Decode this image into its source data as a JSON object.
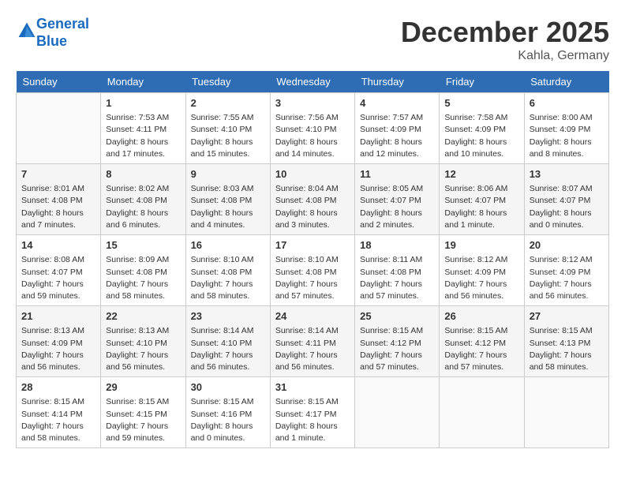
{
  "header": {
    "logo_line1": "General",
    "logo_line2": "Blue",
    "month": "December 2025",
    "location": "Kahla, Germany"
  },
  "weekdays": [
    "Sunday",
    "Monday",
    "Tuesday",
    "Wednesday",
    "Thursday",
    "Friday",
    "Saturday"
  ],
  "weeks": [
    [
      {
        "day": "",
        "empty": true
      },
      {
        "day": "1",
        "sunrise": "Sunrise: 7:53 AM",
        "sunset": "Sunset: 4:11 PM",
        "daylight": "Daylight: 8 hours and 17 minutes."
      },
      {
        "day": "2",
        "sunrise": "Sunrise: 7:55 AM",
        "sunset": "Sunset: 4:10 PM",
        "daylight": "Daylight: 8 hours and 15 minutes."
      },
      {
        "day": "3",
        "sunrise": "Sunrise: 7:56 AM",
        "sunset": "Sunset: 4:10 PM",
        "daylight": "Daylight: 8 hours and 14 minutes."
      },
      {
        "day": "4",
        "sunrise": "Sunrise: 7:57 AM",
        "sunset": "Sunset: 4:09 PM",
        "daylight": "Daylight: 8 hours and 12 minutes."
      },
      {
        "day": "5",
        "sunrise": "Sunrise: 7:58 AM",
        "sunset": "Sunset: 4:09 PM",
        "daylight": "Daylight: 8 hours and 10 minutes."
      },
      {
        "day": "6",
        "sunrise": "Sunrise: 8:00 AM",
        "sunset": "Sunset: 4:09 PM",
        "daylight": "Daylight: 8 hours and 8 minutes."
      }
    ],
    [
      {
        "day": "7",
        "sunrise": "Sunrise: 8:01 AM",
        "sunset": "Sunset: 4:08 PM",
        "daylight": "Daylight: 8 hours and 7 minutes."
      },
      {
        "day": "8",
        "sunrise": "Sunrise: 8:02 AM",
        "sunset": "Sunset: 4:08 PM",
        "daylight": "Daylight: 8 hours and 6 minutes."
      },
      {
        "day": "9",
        "sunrise": "Sunrise: 8:03 AM",
        "sunset": "Sunset: 4:08 PM",
        "daylight": "Daylight: 8 hours and 4 minutes."
      },
      {
        "day": "10",
        "sunrise": "Sunrise: 8:04 AM",
        "sunset": "Sunset: 4:08 PM",
        "daylight": "Daylight: 8 hours and 3 minutes."
      },
      {
        "day": "11",
        "sunrise": "Sunrise: 8:05 AM",
        "sunset": "Sunset: 4:07 PM",
        "daylight": "Daylight: 8 hours and 2 minutes."
      },
      {
        "day": "12",
        "sunrise": "Sunrise: 8:06 AM",
        "sunset": "Sunset: 4:07 PM",
        "daylight": "Daylight: 8 hours and 1 minute."
      },
      {
        "day": "13",
        "sunrise": "Sunrise: 8:07 AM",
        "sunset": "Sunset: 4:07 PM",
        "daylight": "Daylight: 8 hours and 0 minutes."
      }
    ],
    [
      {
        "day": "14",
        "sunrise": "Sunrise: 8:08 AM",
        "sunset": "Sunset: 4:07 PM",
        "daylight": "Daylight: 7 hours and 59 minutes."
      },
      {
        "day": "15",
        "sunrise": "Sunrise: 8:09 AM",
        "sunset": "Sunset: 4:08 PM",
        "daylight": "Daylight: 7 hours and 58 minutes."
      },
      {
        "day": "16",
        "sunrise": "Sunrise: 8:10 AM",
        "sunset": "Sunset: 4:08 PM",
        "daylight": "Daylight: 7 hours and 58 minutes."
      },
      {
        "day": "17",
        "sunrise": "Sunrise: 8:10 AM",
        "sunset": "Sunset: 4:08 PM",
        "daylight": "Daylight: 7 hours and 57 minutes."
      },
      {
        "day": "18",
        "sunrise": "Sunrise: 8:11 AM",
        "sunset": "Sunset: 4:08 PM",
        "daylight": "Daylight: 7 hours and 57 minutes."
      },
      {
        "day": "19",
        "sunrise": "Sunrise: 8:12 AM",
        "sunset": "Sunset: 4:09 PM",
        "daylight": "Daylight: 7 hours and 56 minutes."
      },
      {
        "day": "20",
        "sunrise": "Sunrise: 8:12 AM",
        "sunset": "Sunset: 4:09 PM",
        "daylight": "Daylight: 7 hours and 56 minutes."
      }
    ],
    [
      {
        "day": "21",
        "sunrise": "Sunrise: 8:13 AM",
        "sunset": "Sunset: 4:09 PM",
        "daylight": "Daylight: 7 hours and 56 minutes."
      },
      {
        "day": "22",
        "sunrise": "Sunrise: 8:13 AM",
        "sunset": "Sunset: 4:10 PM",
        "daylight": "Daylight: 7 hours and 56 minutes."
      },
      {
        "day": "23",
        "sunrise": "Sunrise: 8:14 AM",
        "sunset": "Sunset: 4:10 PM",
        "daylight": "Daylight: 7 hours and 56 minutes."
      },
      {
        "day": "24",
        "sunrise": "Sunrise: 8:14 AM",
        "sunset": "Sunset: 4:11 PM",
        "daylight": "Daylight: 7 hours and 56 minutes."
      },
      {
        "day": "25",
        "sunrise": "Sunrise: 8:15 AM",
        "sunset": "Sunset: 4:12 PM",
        "daylight": "Daylight: 7 hours and 57 minutes."
      },
      {
        "day": "26",
        "sunrise": "Sunrise: 8:15 AM",
        "sunset": "Sunset: 4:12 PM",
        "daylight": "Daylight: 7 hours and 57 minutes."
      },
      {
        "day": "27",
        "sunrise": "Sunrise: 8:15 AM",
        "sunset": "Sunset: 4:13 PM",
        "daylight": "Daylight: 7 hours and 58 minutes."
      }
    ],
    [
      {
        "day": "28",
        "sunrise": "Sunrise: 8:15 AM",
        "sunset": "Sunset: 4:14 PM",
        "daylight": "Daylight: 7 hours and 58 minutes."
      },
      {
        "day": "29",
        "sunrise": "Sunrise: 8:15 AM",
        "sunset": "Sunset: 4:15 PM",
        "daylight": "Daylight: 7 hours and 59 minutes."
      },
      {
        "day": "30",
        "sunrise": "Sunrise: 8:15 AM",
        "sunset": "Sunset: 4:16 PM",
        "daylight": "Daylight: 8 hours and 0 minutes."
      },
      {
        "day": "31",
        "sunrise": "Sunrise: 8:15 AM",
        "sunset": "Sunset: 4:17 PM",
        "daylight": "Daylight: 8 hours and 1 minute."
      },
      {
        "day": "",
        "empty": true
      },
      {
        "day": "",
        "empty": true
      },
      {
        "day": "",
        "empty": true
      }
    ]
  ]
}
